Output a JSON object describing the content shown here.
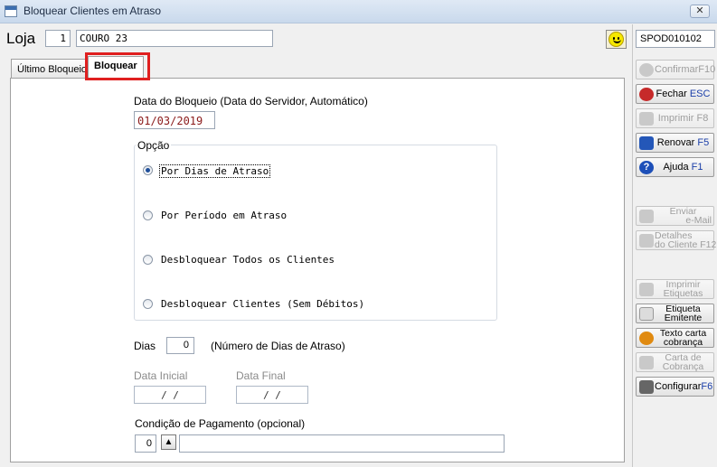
{
  "window": {
    "title": "Bloquear Clientes em Atraso",
    "close": "✕"
  },
  "header": {
    "loja_label": "Loja",
    "loja_number": "1",
    "loja_name": "COURO 23",
    "code": "SPOD010102"
  },
  "tabs": [
    {
      "label": "Último Bloqueio"
    },
    {
      "label": "Bloquear"
    }
  ],
  "form": {
    "date_label": "Data do Bloqueio (Data do Servidor, Automático)",
    "date_value": "01/03/2019",
    "opcao_title": "Opção",
    "options": [
      {
        "label": "Por Dias de Atraso",
        "selected": true
      },
      {
        "label": "Por Período em Atraso",
        "selected": false
      },
      {
        "label": "Desbloquear Todos os Clientes",
        "selected": false
      },
      {
        "label": "Desbloquear Clientes (Sem Débitos)",
        "selected": false
      }
    ],
    "dias_label": "Dias",
    "dias_value": "0",
    "dias_hint": "(Número de Dias de Atraso)",
    "data_inicial_label": "Data Inicial",
    "data_inicial_value": "/  /",
    "data_final_label": "Data Final",
    "data_final_value": "/  /",
    "condicao_label": "Condição de Pagamento (opcional)",
    "condicao_value": "0"
  },
  "buttons": {
    "confirmar": {
      "label": "Confirmar",
      "key": "F10"
    },
    "fechar": {
      "label": "Fechar",
      "key": "ESC"
    },
    "imprimir": {
      "label": "Imprimir",
      "key": "F8"
    },
    "renovar": {
      "label": "Renovar",
      "key": "F5"
    },
    "ajuda": {
      "label": "Ajuda",
      "key": "F1"
    },
    "enviar_line1": "Enviar",
    "enviar_line2": "e-Mail",
    "detalhes_line1": "Detalhes",
    "detalhes_line2": "do Cliente",
    "detalhes_key": "F12",
    "imprimir_etiquetas_line1": "Imprimir",
    "imprimir_etiquetas_line2": "Etiquetas",
    "etiqueta_line1": "Etiqueta",
    "etiqueta_line2": "Emitente",
    "texto_carta_line1": "Texto carta",
    "texto_carta_line2": "cobrança",
    "carta_line1": "Carta de",
    "carta_line2": "Cobrança",
    "configurar": {
      "label": "Configurar",
      "key": "F6"
    }
  },
  "colors": {
    "highlight": "#e02020",
    "date_text": "#8b1a1a",
    "key_text": "#1a3ea8"
  }
}
